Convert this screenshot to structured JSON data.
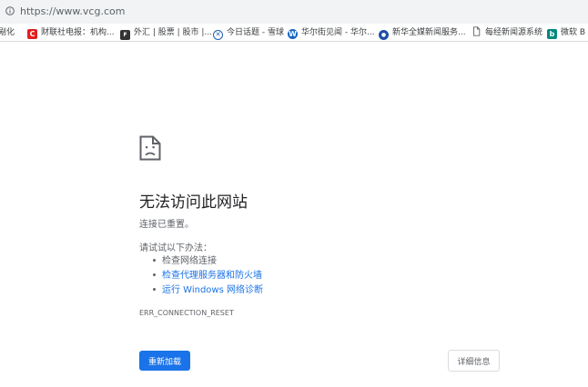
{
  "omnibox": {
    "url": "https://www.vcg.com",
    "icon": "info-icon"
  },
  "bookmarks": [
    {
      "label": "剐化",
      "icon": "none"
    },
    {
      "label": "财联社电报：机构...",
      "icon": "cls-favicon",
      "color": "#e02020",
      "glyph": "C"
    },
    {
      "label": "外汇 | 股票 | 股市 |...",
      "icon": "fx-favicon",
      "color": "#333333",
      "glyph": "F"
    },
    {
      "label": "今日话题 - 雪球",
      "icon": "xueqiu-favicon",
      "color": "#1f5fae",
      "glyph": "✕"
    },
    {
      "label": "华尔街见闻 - 华尔...",
      "icon": "wallstreetcn-favicon",
      "color": "#1565c0",
      "glyph": "W"
    },
    {
      "label": "新华全媒新闻服务...",
      "icon": "xinhua-favicon",
      "color": "#1e4fa3",
      "glyph": "●"
    },
    {
      "label": "每经新闻源系统",
      "icon": "page-icon",
      "color": "#ffffff",
      "glyph": ""
    },
    {
      "label": "微软 B",
      "icon": "bing-favicon",
      "color": "#00897b",
      "glyph": "b"
    }
  ],
  "error": {
    "title": "无法访问此网站",
    "subtitle": "连接已重置。",
    "try_label": "请试试以下办法：",
    "suggestions": [
      {
        "text": "检查网络连接",
        "link": false
      },
      {
        "text": "检查代理服务器和防火墙",
        "link": true
      },
      {
        "text": "运行 Windows 网络诊断",
        "link": true
      }
    ],
    "code": "ERR_CONNECTION_RESET"
  },
  "buttons": {
    "reload": "重新加载",
    "details": "详细信息"
  },
  "colors": {
    "accent": "#1a73e8",
    "link": "#1a73e8",
    "text_secondary": "#5f6368"
  }
}
